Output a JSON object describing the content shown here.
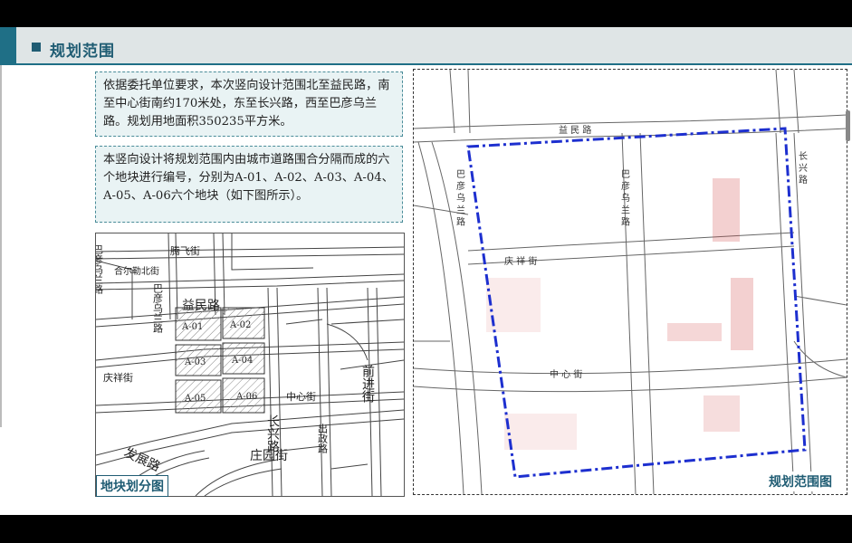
{
  "header": {
    "title": "规划范围"
  },
  "intro_text": "依据委托单位要求，本次竖向设计范围北至益民路，南至中心街南约170米处，东至长兴路，西至巴彦乌兰路。规划用地面积350235平方米。",
  "parcel_text": "本竖向设计将规划范围内由城市道路围合分隔而成的六个地块进行编号，分别为A-01、A-02、A-03、A-04、A-05、A-06六个地块（如下图所示）。",
  "block_map": {
    "caption": "地块划分图",
    "roads": {
      "tengfei": "腾飞街",
      "bayanwulan": "巴彦乌兰路",
      "yimin": "益民路",
      "bayanwulan_n": "巴彦乌兰路",
      "qingxiang": "庆祥街",
      "zhongxin": "中心街",
      "qianjin": "前进街",
      "fazhan": "发展路",
      "changxing": "长兴路",
      "zhuangyuan": "庄园街",
      "chuzheng": "出政路",
      "heersheng": "合尔勒北街"
    },
    "parcels": [
      "A-01",
      "A-02",
      "A-03",
      "A-04",
      "A-05",
      "A-06"
    ]
  },
  "plan_map": {
    "caption": "规划范围图",
    "roads": {
      "yimin": "益 民 路",
      "bayan_w": "巴 彦 乌 兰 路",
      "bayan_n": "巴 彦 乌 兰 路",
      "qingxiang": "庆 祥 街",
      "zhongxin": "中 心 街",
      "changxing": "长 兴 路"
    }
  }
}
